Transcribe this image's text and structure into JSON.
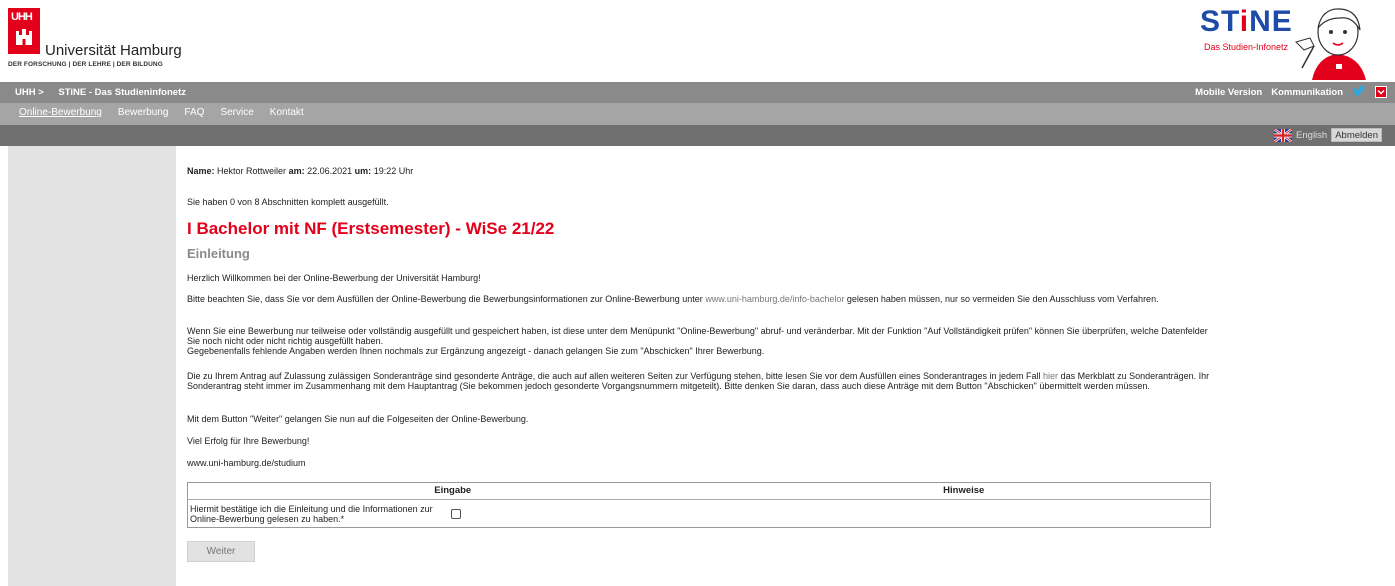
{
  "header": {
    "logo_mark": "UHH",
    "university_name": "Universität Hamburg",
    "tagline": "DER FORSCHUNG | DER LEHRE | DER BILDUNG",
    "stine_logo_text": "STiNE",
    "stine_subtitle": "Das Studien-Infonetz"
  },
  "topbar": {
    "crumb_home": "UHH >",
    "crumb_current": "STiNE - Das Studieninfonetz",
    "mobile_version": "Mobile Version",
    "communication": "Kommunikation"
  },
  "nav": {
    "items": [
      {
        "label": "Online-Bewerbung",
        "active": true
      },
      {
        "label": "Bewerbung",
        "active": false
      },
      {
        "label": "FAQ",
        "active": false
      },
      {
        "label": "Service",
        "active": false
      },
      {
        "label": "Kontakt",
        "active": false
      }
    ]
  },
  "subbar": {
    "language": "English",
    "logout": "Abmelden"
  },
  "info": {
    "name_label": "Name:",
    "name_value": "Hektor Rottweiler",
    "date_label": "am:",
    "date_value": "22.06.2021",
    "time_label": "um:",
    "time_value": "19:22 Uhr"
  },
  "progress_text": "Sie haben 0 von 8 Abschnitten komplett ausgefüllt.",
  "heading": "I Bachelor mit NF (Erstsemester) - WiSe 21/22",
  "section_title": "Einleitung",
  "paragraphs": {
    "p1": "Herzlich Willkommen bei der Online-Bewerbung der Universität Hamburg!",
    "p2_before": "Bitte beachten Sie, dass Sie vor dem Ausfüllen der Online-Bewerbung die Bewerbungsinformationen zur Online-Bewerbung unter ",
    "p2_link": "www.uni-hamburg.de/info-bachelor",
    "p2_after": " gelesen haben müssen, nur so vermeiden Sie den Ausschluss vom Verfahren.",
    "p3_line1": "Wenn Sie eine Bewerbung nur teilweise oder vollständig ausgefüllt und gespeichert haben, ist diese unter dem Menüpunkt \"Online-Bewerbung\" abruf- und veränderbar. Mit der Funktion \"Auf Vollständigkeit prüfen\" können Sie überprüfen, welche Datenfelder Sie noch nicht oder nicht richtig ausgefüllt haben.",
    "p3_line2": "Gegebenenfalls fehlende Angaben werden Ihnen nochmals zur Ergänzung angezeigt - danach gelangen Sie zum \"Abschicken\" Ihrer Bewerbung.",
    "p4_before": "Die zu Ihrem Antrag auf Zulassung zulässigen Sonderanträge sind gesonderte Anträge, die auch auf allen weiteren Seiten zur Verfügung stehen, bitte lesen Sie vor dem Ausfüllen eines Sonderantrages in jedem Fall ",
    "p4_link": "hier",
    "p4_after": " das Merkblatt zu Sonderanträgen. Ihr Sonderantrag steht immer im Zusammenhang mit dem Hauptantrag (Sie bekommen jedoch gesonderte Vorgangsnummern mitgeteilt). Bitte denken Sie daran, dass auch diese Anträge mit dem Button \"Abschicken\" übermittelt werden müssen.",
    "p5": "Mit dem Button \"Weiter\" gelangen Sie nun auf die Folgeseiten der Online-Bewerbung.",
    "p6": "Viel Erfolg für Ihre Bewerbung!",
    "p7": "www.uni-hamburg.de/studium"
  },
  "table": {
    "col_input": "Eingabe",
    "col_hints": "Hinweise",
    "confirm_text": "Hiermit bestätige ich die Einleitung und die Informationen zur Online-Bewerbung gelesen zu haben.*",
    "checked": false
  },
  "next_button": "Weiter",
  "colors": {
    "accent_red": "#e2001a",
    "stine_blue": "#1e4aa8",
    "topbar_gray": "#8a8a8a",
    "nav_gray": "#a5a5a5",
    "subbar_gray": "#6f6f6f",
    "sidebar_gray": "#e3e3e3"
  }
}
